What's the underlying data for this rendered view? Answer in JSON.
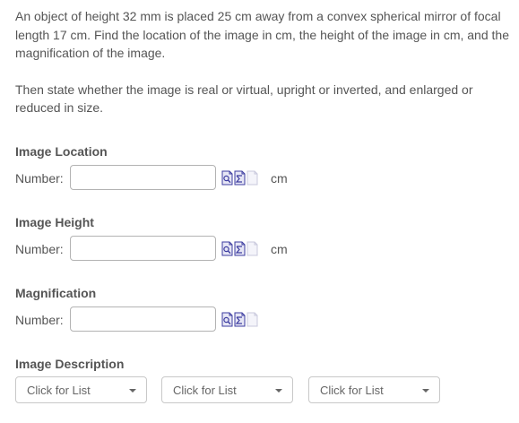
{
  "question": {
    "paragraph1": "An object of height 32 mm is placed 25 cm away from a convex spherical mirror of focal length 17 cm. Find the location of the image in cm, the height of the image in cm, and the magnification of the image.",
    "paragraph2": "Then state whether the image is real or virtual, upright or inverted, and enlarged or reduced in size."
  },
  "sections": {
    "image_location": {
      "title": "Image Location",
      "number_label": "Number:",
      "value": "",
      "unit": "cm"
    },
    "image_height": {
      "title": "Image Height",
      "number_label": "Number:",
      "value": "",
      "unit": "cm"
    },
    "magnification": {
      "title": "Magnification",
      "number_label": "Number:",
      "value": ""
    },
    "image_description": {
      "title": "Image Description",
      "selects": [
        {
          "selected": "Click for List"
        },
        {
          "selected": "Click for List"
        },
        {
          "selected": "Click for List"
        }
      ]
    }
  },
  "icons": {
    "tool1": "equation-editor-icon",
    "tool2": "tolerance-icon",
    "tool3": "help-page-icon"
  },
  "colors": {
    "text": "#555555",
    "input_border": "#b3b3b3",
    "icon_blue": "#3c3ca0",
    "icon_faded": "#c8c8dc"
  }
}
